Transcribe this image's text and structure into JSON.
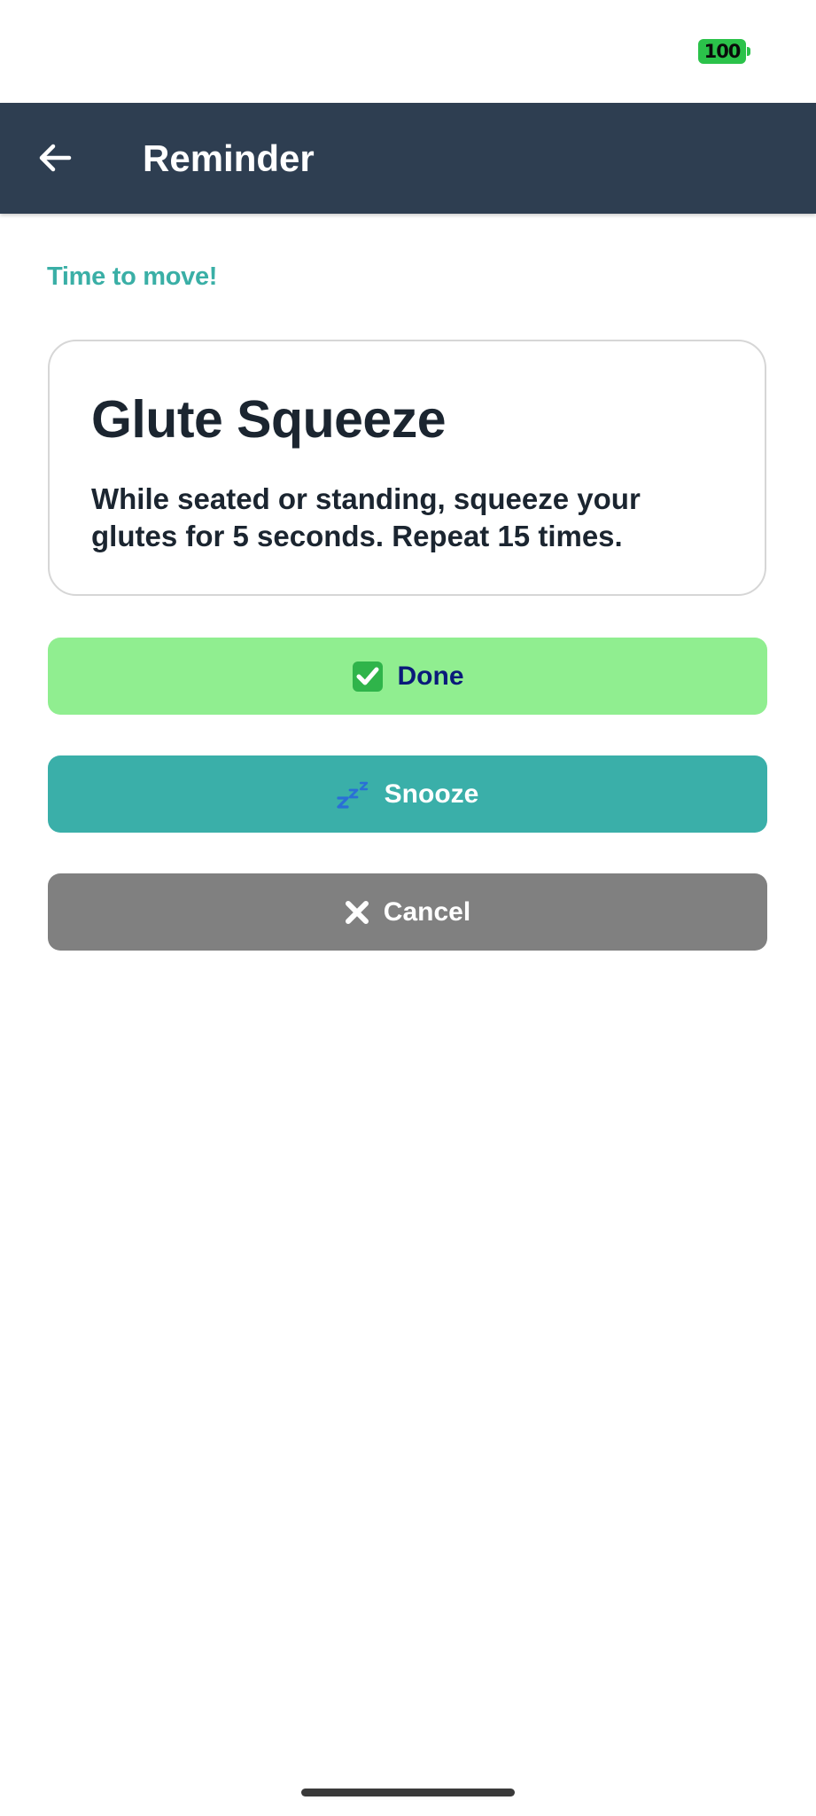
{
  "status_bar": {
    "battery_level": "100",
    "battery_color": "#2bc24a"
  },
  "app_bar": {
    "title": "Reminder",
    "back_icon": "arrow-left-icon",
    "background": "#2e3e51"
  },
  "main": {
    "prompt": "Time to move!",
    "exercise": {
      "title": "Glute Squeeze",
      "description": "While seated or standing, squeeze your glutes for 5 seconds. Repeat 15 times."
    },
    "actions": {
      "done": {
        "label": "Done",
        "icon": "check-mark-icon",
        "color": "#90ee90"
      },
      "snooze": {
        "label": "Snooze",
        "icon": "zzz-icon",
        "color": "#3aafa9"
      },
      "cancel": {
        "label": "Cancel",
        "icon": "cross-icon",
        "color": "#808080"
      }
    }
  },
  "colors": {
    "accent": "#3aafa6",
    "text_dark": "#1b2530"
  }
}
